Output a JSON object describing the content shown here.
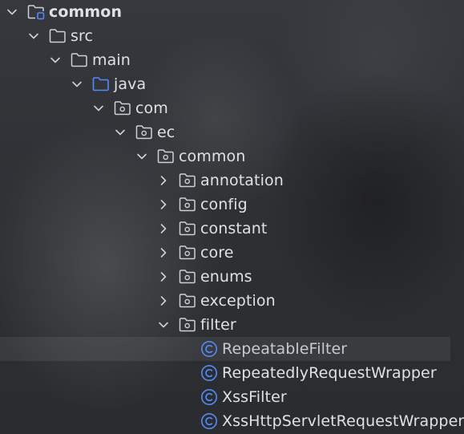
{
  "project_tree": {
    "colors": {
      "text": "#dfe1e5",
      "folder_icon": "#ced0d6",
      "source_root_icon": "#548af7",
      "class_icon": "#548af7",
      "chevron": "#ced0d6"
    },
    "nodes": [
      {
        "label": "common",
        "icon": "module-folder-icon",
        "state": "expanded"
      },
      {
        "label": "src",
        "icon": "folder-icon",
        "state": "expanded"
      },
      {
        "label": "main",
        "icon": "folder-icon",
        "state": "expanded"
      },
      {
        "label": "java",
        "icon": "source-root-folder-icon",
        "state": "expanded"
      },
      {
        "label": "com",
        "icon": "package-icon",
        "state": "expanded"
      },
      {
        "label": "ec",
        "icon": "package-icon",
        "state": "expanded"
      },
      {
        "label": "common",
        "icon": "package-icon",
        "state": "expanded"
      },
      {
        "label": "annotation",
        "icon": "package-icon",
        "state": "collapsed"
      },
      {
        "label": "config",
        "icon": "package-icon",
        "state": "collapsed"
      },
      {
        "label": "constant",
        "icon": "package-icon",
        "state": "collapsed"
      },
      {
        "label": "core",
        "icon": "package-icon",
        "state": "collapsed"
      },
      {
        "label": "enums",
        "icon": "package-icon",
        "state": "collapsed"
      },
      {
        "label": "exception",
        "icon": "package-icon",
        "state": "collapsed"
      },
      {
        "label": "filter",
        "icon": "package-icon",
        "state": "expanded"
      },
      {
        "label": "RepeatableFilter",
        "icon": "class-icon",
        "state": "leaf",
        "selected": true
      },
      {
        "label": "RepeatedlyRequestWrapper",
        "icon": "class-icon",
        "state": "leaf"
      },
      {
        "label": "XssFilter",
        "icon": "class-icon",
        "state": "leaf"
      },
      {
        "label": "XssHttpServletRequestWrapper",
        "icon": "class-icon",
        "state": "leaf"
      }
    ]
  }
}
